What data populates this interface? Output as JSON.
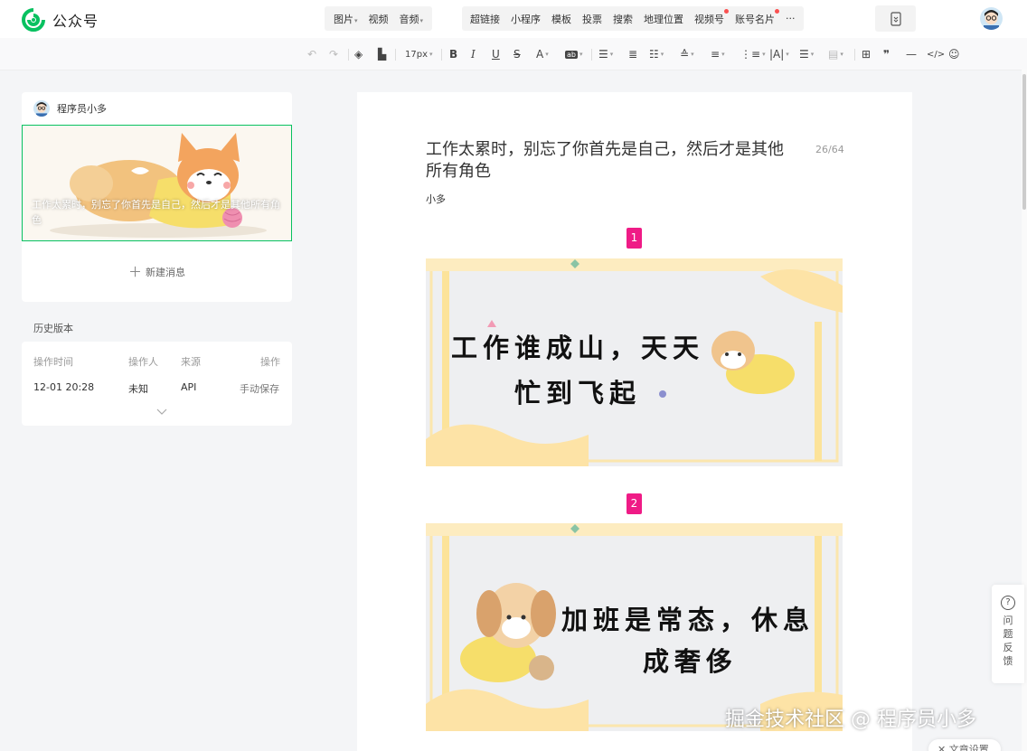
{
  "brand": {
    "name": "公众号"
  },
  "media_left": [
    {
      "label": "图片",
      "dropdown": true
    },
    {
      "label": "视频",
      "dropdown": false
    },
    {
      "label": "音频",
      "dropdown": true
    }
  ],
  "media_right": [
    {
      "label": "超链接",
      "dot": false
    },
    {
      "label": "小程序",
      "dot": false
    },
    {
      "label": "模板",
      "dot": false
    },
    {
      "label": "投票",
      "dot": false
    },
    {
      "label": "搜索",
      "dot": false
    },
    {
      "label": "地理位置",
      "dot": false
    },
    {
      "label": "视频号",
      "dot": true
    },
    {
      "label": "账号名片",
      "dot": true
    },
    {
      "label": "···",
      "dot": false
    }
  ],
  "toolbar": {
    "font_size": "17px"
  },
  "account": {
    "name": "程序员小多"
  },
  "cover": {
    "caption": "工作太累时，别忘了你首先是自己，然后才是其他所有角色"
  },
  "new_message": {
    "label": "新建消息"
  },
  "history": {
    "title": "历史版本",
    "headers": {
      "time": "操作时间",
      "operator": "操作人",
      "source": "来源",
      "action": "操作"
    },
    "row": {
      "time": "12-01 20:28",
      "operator": "未知",
      "source": "API",
      "action": "手动保存"
    }
  },
  "article": {
    "title": "工作太累时，别忘了你首先是自己，然后才是其他所有角色",
    "counter": "26/64",
    "author": "小多",
    "slides": [
      {
        "badge": "1",
        "lines": [
          "工作谁成山，天天",
          "忙到飞起"
        ]
      },
      {
        "badge": "2",
        "lines": [
          "加班是常态，休息",
          "成奢侈"
        ]
      }
    ]
  },
  "feedback": {
    "label": "问题反馈"
  },
  "settings": {
    "label": "文章设置"
  },
  "watermark": {
    "text": "掘金技术社区 @ 程序员小多"
  },
  "colors": {
    "brand_green": "#07c160",
    "badge_pink": "#ef1b86",
    "notice_red": "#fa5151"
  }
}
